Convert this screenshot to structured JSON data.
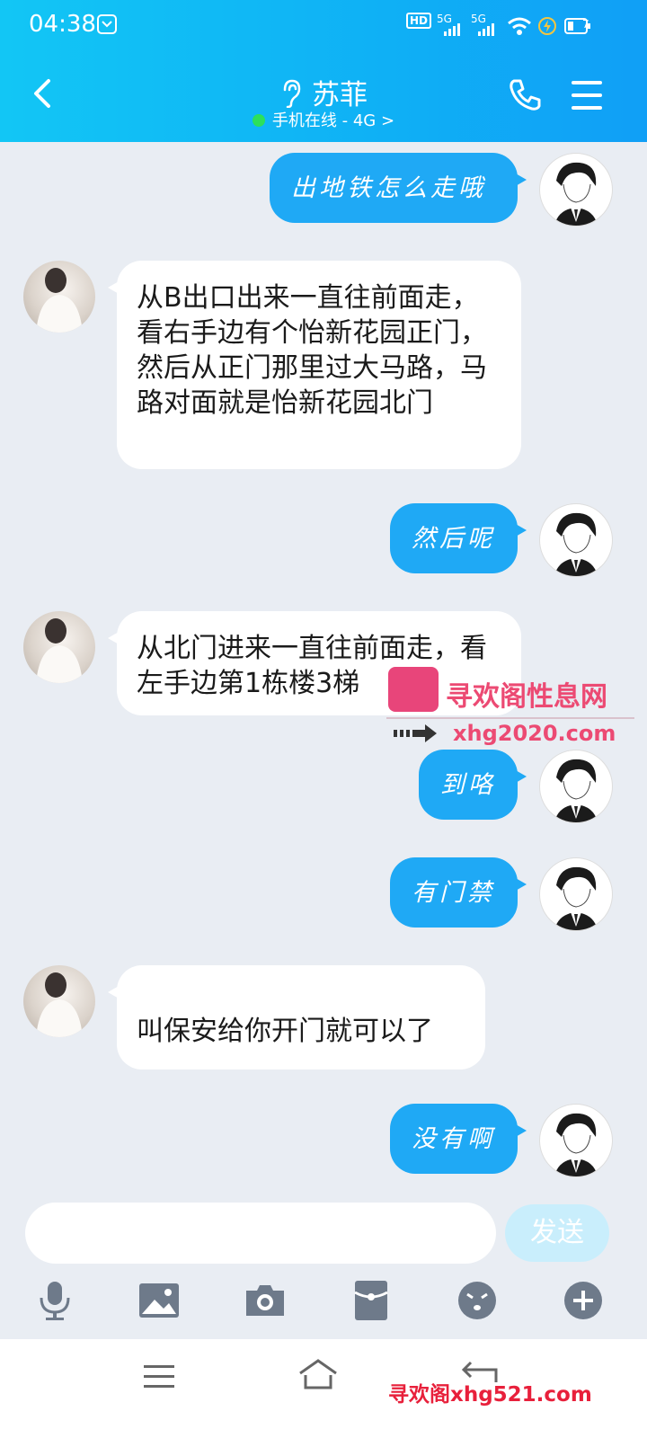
{
  "status": {
    "time": "04:38",
    "net1": "5G",
    "net2": "5G",
    "hd": "HD",
    "battery": "7"
  },
  "header": {
    "name": "苏菲",
    "online": "手机在线 - 4G >"
  },
  "messages": [
    {
      "side": "me",
      "text": "出地铁怎么走哦"
    },
    {
      "side": "her",
      "text": "从B出口出来一直往前面走，看右手边有个怡新花园正门，然后从正门那里过大马路，马路对面就是怡新花园北门"
    },
    {
      "side": "me",
      "text": "然后呢"
    },
    {
      "side": "her",
      "text": "从北门进来一直往前面走，看左手边第1栋楼3梯"
    },
    {
      "side": "me",
      "text": "到咯"
    },
    {
      "side": "me",
      "text": "有门禁"
    },
    {
      "side": "her",
      "text": "叫保安给你开门就可以了"
    },
    {
      "side": "me",
      "text": "没有啊"
    }
  ],
  "watermark": {
    "brand": "寻欢阁性息网",
    "url": "xhg2020.com",
    "bottom": "寻欢阁xhg521.com"
  },
  "input": {
    "send_label": "发送"
  },
  "colors": {
    "header": "#12b6f5",
    "my_bubble": "#1fa9f5",
    "bg": "#e9edf3"
  },
  "icons": [
    "back-icon",
    "ear-icon",
    "phone-icon",
    "menu-icon",
    "mic-icon",
    "image-icon",
    "camera-icon",
    "redpacket-icon",
    "emoji-icon",
    "plus-icon"
  ]
}
